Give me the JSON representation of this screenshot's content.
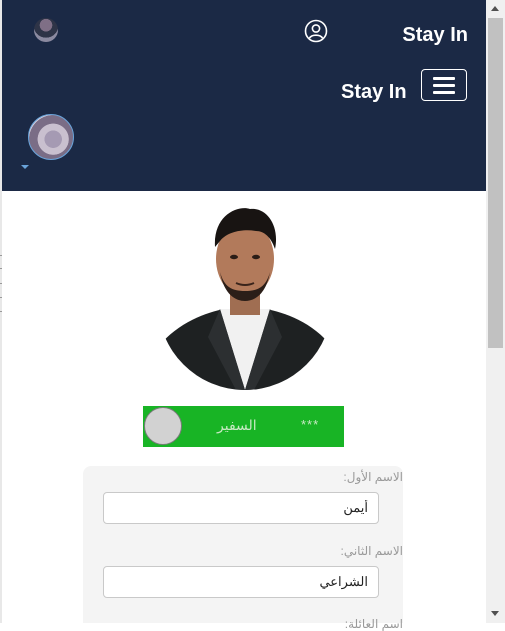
{
  "header": {
    "brand_top": "Stay In",
    "brand_menu": "Stay In",
    "icons": {
      "user": "user-circle-icon",
      "menu": "hamburger-icon",
      "dropdown": "caret-down-icon"
    },
    "colors": {
      "background": "#1b2945",
      "text": "#ffffff"
    }
  },
  "profile": {
    "status_name": "السفير",
    "status_stars": "***",
    "status_color": "#18b425"
  },
  "form": {
    "first_name_label": "الاسم الأول:",
    "first_name_value": "أيمن",
    "second_name_label": "الاسم الثاني:",
    "second_name_value": "الشراعي",
    "third_label": "اسم العائلة:"
  }
}
